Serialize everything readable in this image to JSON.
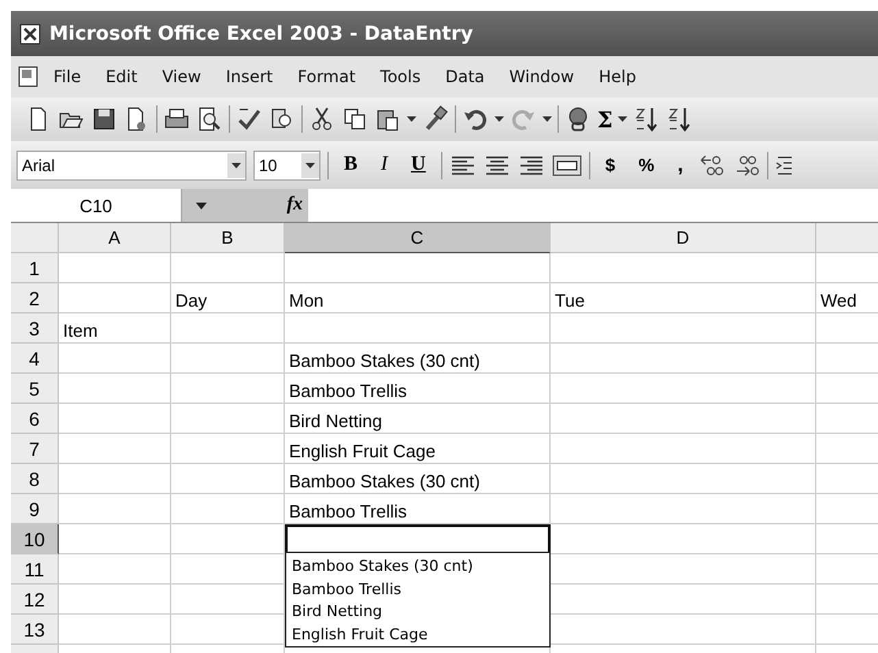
{
  "window": {
    "title": "Microsoft Office Excel 2003 - DataEntry"
  },
  "menu": [
    "File",
    "Edit",
    "View",
    "Insert",
    "Format",
    "Tools",
    "Data",
    "Window",
    "Help"
  ],
  "toolbar": {
    "sum": "Σ"
  },
  "format_toolbar": {
    "font": "Arial",
    "size": "10",
    "bold": "B",
    "italic": "I",
    "underline": "U",
    "currency": "$",
    "percent": "%",
    "comma": ","
  },
  "formula_bar": {
    "name_box": "C10",
    "fx": "fx"
  },
  "columns": [
    {
      "label": "A",
      "selected": false
    },
    {
      "label": "B",
      "selected": false
    },
    {
      "label": "C",
      "selected": true
    },
    {
      "label": "D",
      "selected": false
    },
    {
      "selected": false
    }
  ],
  "rows": [
    {
      "number": "1",
      "selected": false,
      "cells": [
        null,
        null,
        null,
        null,
        null
      ]
    },
    {
      "number": "2",
      "selected": false,
      "cells": [
        null,
        "Day",
        "Mon",
        "Tue",
        "Wed"
      ]
    },
    {
      "number": "3",
      "selected": false,
      "cells": [
        "Item",
        null,
        null,
        null,
        null
      ]
    },
    {
      "number": "4",
      "selected": false,
      "cells": [
        null,
        null,
        "Bamboo Stakes (30 cnt)",
        null,
        null
      ]
    },
    {
      "number": "5",
      "selected": false,
      "cells": [
        null,
        null,
        "Bamboo Trellis",
        null,
        null
      ]
    },
    {
      "number": "6",
      "selected": false,
      "cells": [
        null,
        null,
        "Bird Netting",
        null,
        null
      ]
    },
    {
      "number": "7",
      "selected": false,
      "cells": [
        null,
        null,
        "English Fruit Cage",
        null,
        null
      ]
    },
    {
      "number": "8",
      "selected": false,
      "cells": [
        null,
        null,
        "Bamboo Stakes (30 cnt)",
        null,
        null
      ]
    },
    {
      "number": "9",
      "selected": false,
      "cells": [
        null,
        null,
        "Bamboo Trellis",
        null,
        null
      ]
    },
    {
      "number": "10",
      "selected": true,
      "cells": [
        null,
        null,
        null,
        null,
        null
      ]
    },
    {
      "number": "11",
      "selected": false,
      "cells": [
        null,
        null,
        null,
        null,
        null
      ]
    },
    {
      "number": "12",
      "selected": false,
      "cells": [
        null,
        null,
        null,
        null,
        null
      ]
    },
    {
      "number": "13",
      "selected": false,
      "cells": [
        null,
        null,
        null,
        null,
        null
      ]
    }
  ],
  "pick_list": {
    "items": [
      "Bamboo Stakes (30 cnt)",
      "Bamboo Trellis",
      "Bird Netting",
      "English Fruit Cage"
    ]
  }
}
